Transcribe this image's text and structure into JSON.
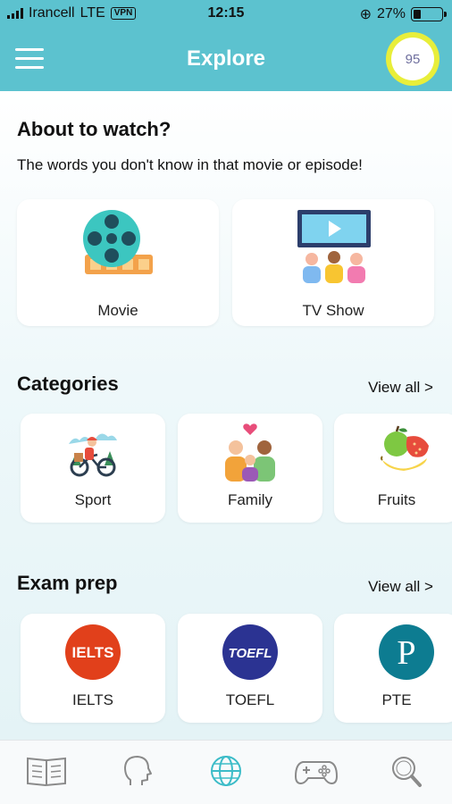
{
  "status_bar": {
    "carrier": "Irancell",
    "network": "LTE",
    "vpn": "VPN",
    "time": "12:15",
    "battery": "27%",
    "battery_level": 0.27
  },
  "header": {
    "title": "Explore",
    "score": "95"
  },
  "watch": {
    "title": "About to watch?",
    "subtitle": "The words you don't know in that movie or episode!",
    "cards": [
      {
        "label": "Movie",
        "icon": "film-reel-icon"
      },
      {
        "label": "TV Show",
        "icon": "tv-audience-icon"
      }
    ]
  },
  "categories": {
    "title": "Categories",
    "view_all": "View all >",
    "items": [
      {
        "label": "Sport",
        "icon": "cyclist-icon"
      },
      {
        "label": "Family",
        "icon": "family-icon"
      },
      {
        "label": "Fruits",
        "icon": "fruits-icon"
      }
    ]
  },
  "exam": {
    "title": "Exam prep",
    "view_all": "View all >",
    "items": [
      {
        "label": "IELTS",
        "logo_text": "IELTS",
        "color": "#e1401b"
      },
      {
        "label": "TOEFL",
        "logo_text": "TOEFL",
        "color": "#2b3392"
      },
      {
        "label": "PTE",
        "logo_text": "P",
        "color": "#0d7c91"
      }
    ]
  },
  "nav": {
    "tabs": [
      {
        "icon": "book-icon",
        "active": false
      },
      {
        "icon": "head-icon",
        "active": false
      },
      {
        "icon": "globe-icon",
        "active": true
      },
      {
        "icon": "gamepad-icon",
        "active": false
      },
      {
        "icon": "search-icon",
        "active": false
      }
    ]
  },
  "colors": {
    "accent": "#5cc2cf",
    "score_ring": "#e8ee3a"
  }
}
